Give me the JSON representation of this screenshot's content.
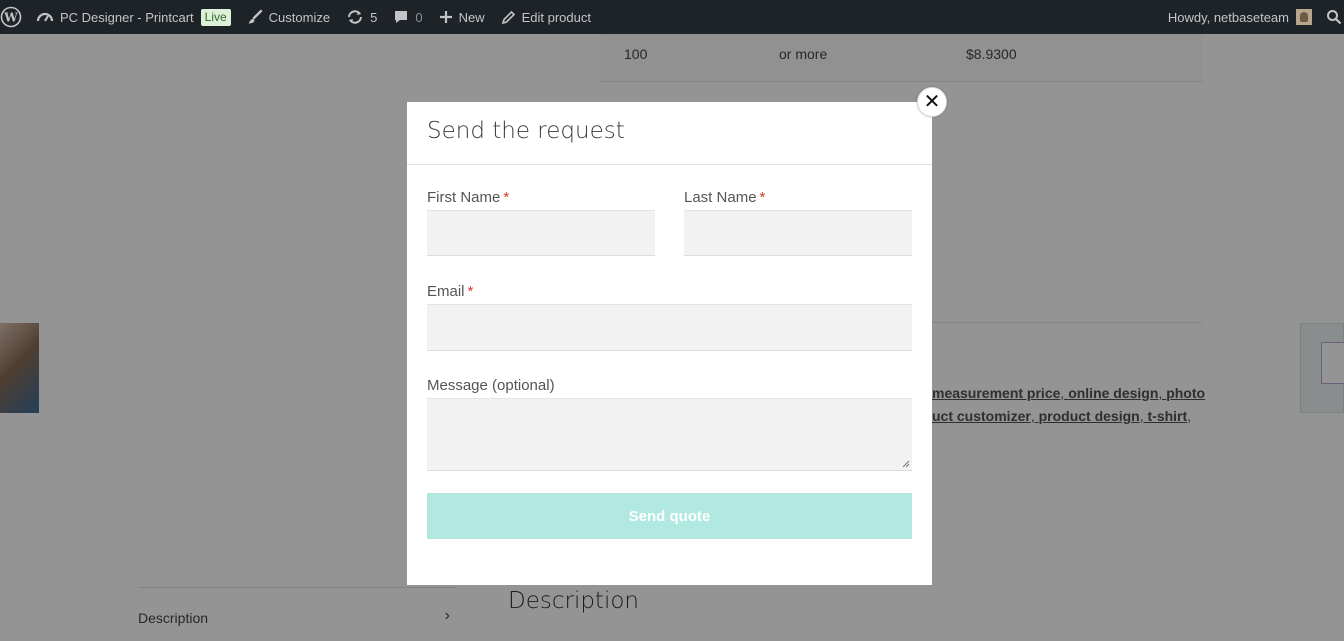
{
  "adminbar": {
    "site_name": "PC Designer - Printcart",
    "live_badge": "Live",
    "customize": "Customize",
    "updates_count": "5",
    "comments_count": "0",
    "new_label": "New",
    "edit_product": "Edit product",
    "howdy": "Howdy, netbaseteam"
  },
  "background": {
    "price_row": {
      "qty": "100",
      "range": "or more",
      "price": "$8.9300"
    },
    "tags_line1": [
      "measurement price",
      "online design",
      "photo"
    ],
    "tags_line2": [
      "uct customizer",
      "product design",
      "t-shirt"
    ],
    "description_tab": "Description",
    "description_heading": "Description"
  },
  "modal": {
    "title": "Send the request",
    "close_symbol": "✕",
    "required_mark": "*",
    "fields": {
      "first_name_label": "First Name",
      "last_name_label": "Last Name",
      "email_label": "Email",
      "message_label": "Message (optional)"
    },
    "submit_label": "Send quote"
  },
  "colors": {
    "adminbar_bg": "#1d2327",
    "submit_bg": "#b1e8e0",
    "required": "#d9362b",
    "input_bg": "#f2f2f2"
  }
}
